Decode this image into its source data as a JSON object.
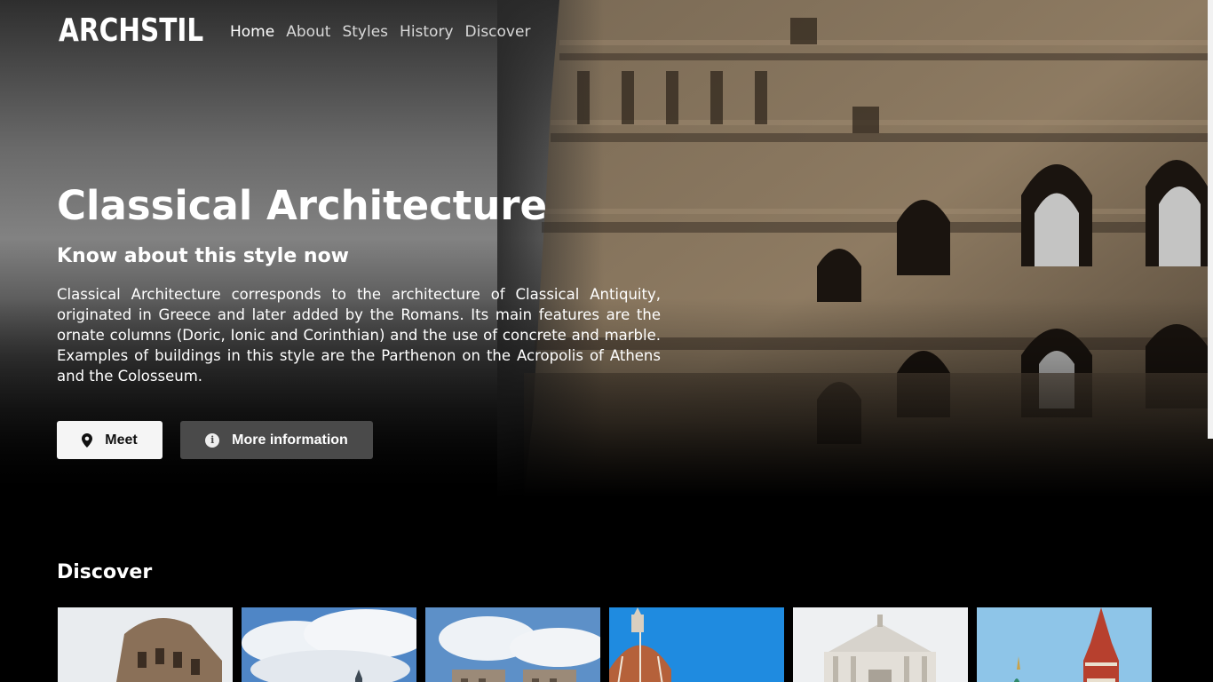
{
  "header": {
    "logo": "ARCHSTIL",
    "nav": [
      {
        "label": "Home",
        "active": true
      },
      {
        "label": "About",
        "active": false
      },
      {
        "label": "Styles",
        "active": false
      },
      {
        "label": "History",
        "active": false
      },
      {
        "label": "Discover",
        "active": false
      }
    ]
  },
  "hero": {
    "title": "Classical Architecture",
    "subtitle": "Know about this style now",
    "description": "Classical Architecture corresponds to the architecture of Classical Antiquity, originated in Greece and later added by the Romans. Its main features are the ornate columns (Doric, Ionic and Corinthian) and the use of concrete and marble. Examples of buildings in this style are the Parthenon on the Acropolis of Athens and the Colosseum.",
    "buttons": {
      "meet": {
        "label": "Meet",
        "icon": "map-pin-icon"
      },
      "more": {
        "label": "More information",
        "icon": "info-circle-icon"
      }
    }
  },
  "discover": {
    "title": "Discover",
    "cards": [
      {
        "name": "colosseum-thumbnail"
      },
      {
        "name": "cathedral-sky-thumbnail"
      },
      {
        "name": "notre-dame-thumbnail"
      },
      {
        "name": "florence-dome-thumbnail"
      },
      {
        "name": "baroque-church-thumbnail"
      },
      {
        "name": "saint-basil-thumbnail"
      }
    ]
  },
  "colors": {
    "background": "#000000",
    "text": "#ffffff",
    "nav_inactive": "#d8d8d8",
    "meet_button": "#f5f5f5",
    "more_button": "#4a4a4a"
  }
}
